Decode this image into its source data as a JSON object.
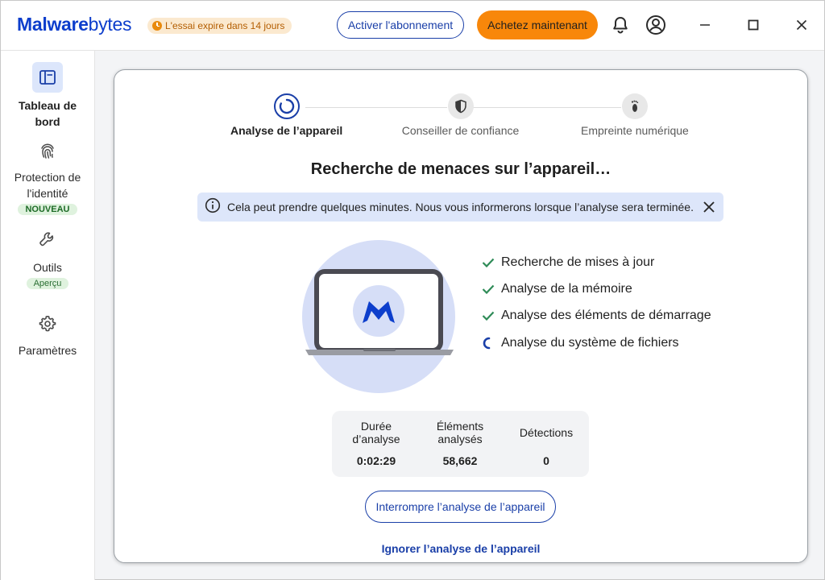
{
  "header": {
    "logo_bold": "Malware",
    "logo_light": "bytes",
    "trial_text": "L'essai expire dans 14 jours",
    "activate_label": "Activer l'abonnement",
    "buy_label": "Achetez maintenant",
    "colors": {
      "brand": "#0d3ecc",
      "buy": "#f8870a",
      "trial_bg": "#fbe9cf"
    }
  },
  "sidebar": {
    "items": [
      {
        "label": "Tableau de bord",
        "icon": "dashboard-icon",
        "active": true
      },
      {
        "label": "Protection de l'identité",
        "icon": "fingerprint-icon",
        "badge": "NOUVEAU"
      },
      {
        "label": "Outils",
        "icon": "wrench-icon",
        "badge": "Aperçu"
      },
      {
        "label": "Paramètres",
        "icon": "gear-icon"
      }
    ]
  },
  "steps": [
    {
      "label": "Analyse de l’appareil",
      "icon": "spinner-icon",
      "active": true
    },
    {
      "label": "Conseiller de confiance",
      "icon": "shield-icon"
    },
    {
      "label": "Empreinte numérique",
      "icon": "footprint-icon"
    }
  ],
  "scan": {
    "title": "Recherche de menaces sur l’appareil…",
    "info": "Cela peut prendre quelques minutes. Nous vous informerons lorsque l’analyse sera terminée.",
    "checklist": [
      {
        "label": "Recherche de mises à jour",
        "status": "done"
      },
      {
        "label": "Analyse de la mémoire",
        "status": "done"
      },
      {
        "label": "Analyse des éléments de démarrage",
        "status": "done"
      },
      {
        "label": "Analyse du système de fichiers",
        "status": "in-progress"
      }
    ],
    "stats": [
      {
        "label": "Durée d’analyse",
        "value": "0:02:29"
      },
      {
        "label": "Éléments analysés",
        "value": "58,662"
      },
      {
        "label": "Détections",
        "value": "0"
      }
    ],
    "stop_label": "Interrompre l’analyse de l’appareil",
    "skip_label": "Ignorer l’analyse de l’appareil"
  }
}
